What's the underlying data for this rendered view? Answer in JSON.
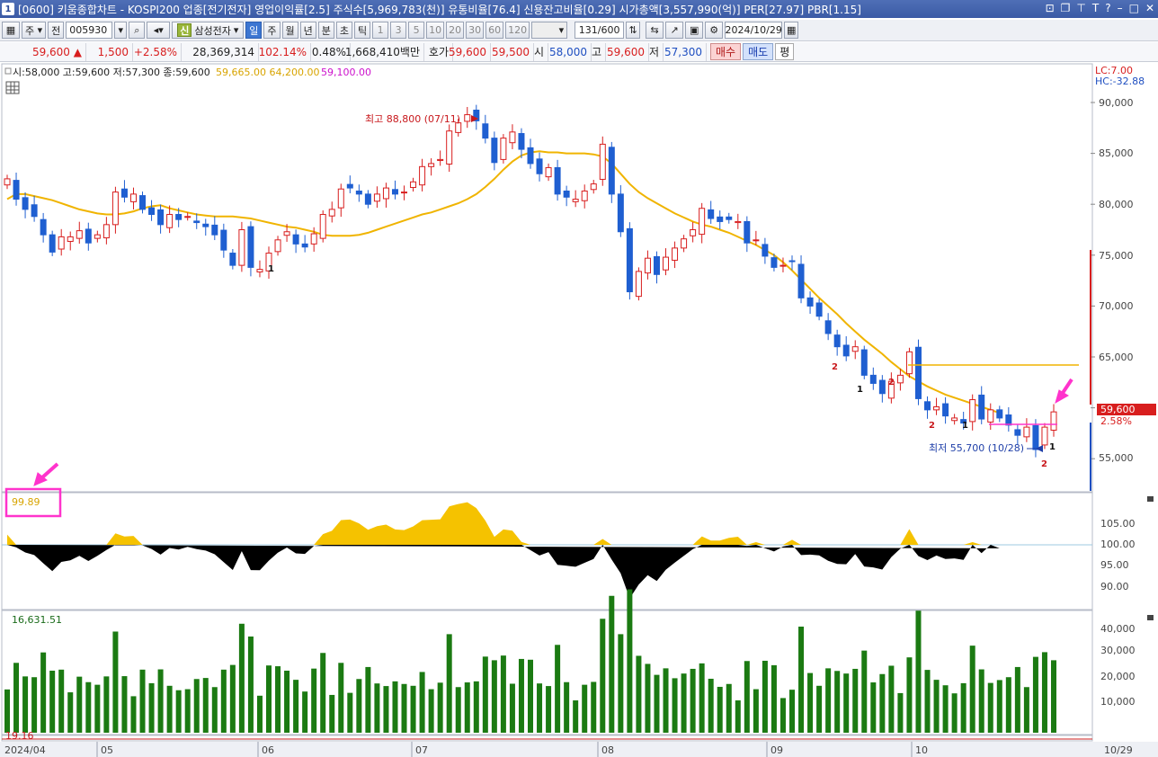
{
  "window": {
    "id": "1",
    "title": "[0600] 키움종합차트 - KOSPI200 업종[전기전자] 영업이익률[2.5] 주식수[5,969,783(천)] 유통비율[76.4] 신용잔고비율[0.29] 시가총액[3,557,990(억)] PER[27.97] PBR[1.15]"
  },
  "toolbar": {
    "market": "주",
    "all": "전",
    "code": "005930",
    "credit_badge": "신",
    "stock_name": "삼성전자",
    "periods": [
      "일",
      "주",
      "월",
      "년",
      "분",
      "초",
      "틱"
    ],
    "active_period": "일",
    "intervals": [
      "1",
      "3",
      "5",
      "10",
      "20",
      "30",
      "60",
      "120"
    ],
    "count": "131",
    "count_max": "/600",
    "date": "2024/10/29"
  },
  "quote": {
    "price": "59,600",
    "arrow": "▲",
    "change": "1,500",
    "change_pct": "+2.58%",
    "volume": "28,369,314",
    "volume_ratio": "102.14%",
    "turnover": "0.48%",
    "amount": "1,668,410백만",
    "hoga_label": "호가",
    "ask": "59,600",
    "bid": "59,500",
    "open_label": "시",
    "open": "58,000",
    "high_label": "고",
    "high": "59,600",
    "low_label": "저",
    "low": "57,300",
    "buy_label": "매수",
    "sell_label": "매도",
    "avg_label": "평"
  },
  "price_panel": {
    "ohlc_legend": "시:58,000 고:59,600 저:57,300 종:59,600",
    "ma_legend_1": "59,665.00 64,200.00",
    "ma_legend_2": "59,100.00",
    "lc": "LC:7.00",
    "hc": "HC:-32.88",
    "max_annotation": "최고 88,800 (07/11)",
    "min_annotation": "최저 55,700 (10/28)",
    "current_price_tag": "59,600",
    "current_pct_tag": "2.58%",
    "y_ticks": [
      "90,000",
      "85,000",
      "80,000",
      "75,000",
      "70,000",
      "65,000",
      "55,000"
    ],
    "colors": {
      "up": "#d81e1e",
      "down": "#1f5fd1",
      "ma": "#f0b400",
      "highlight": "#ff33cc"
    }
  },
  "indicator_panel": {
    "value": "99.89",
    "y_ticks": [
      "105.00",
      "100.00",
      "95.00",
      "90.00"
    ]
  },
  "volume_panel": {
    "value": "16,631.51",
    "y_ticks": [
      "40,000",
      "30,000",
      "20,000",
      "10,000"
    ]
  },
  "bottom_panel": {
    "value": "19.16"
  },
  "x_axis": {
    "labels": [
      "2024/04",
      "05",
      "06",
      "07",
      "08",
      "09",
      "10"
    ],
    "last": "10/29"
  },
  "chart_data": {
    "type": "candlestick",
    "ma_line": [
      80500,
      81000,
      81000,
      80800,
      80600,
      80400,
      80100,
      79800,
      79500,
      79300,
      79100,
      79000,
      79000,
      79100,
      79300,
      79600,
      79800,
      79900,
      79600,
      79400,
      79200,
      79000,
      78900,
      78800,
      78800,
      78800,
      78700,
      78600,
      78400,
      78200,
      78000,
      77800,
      77700,
      77500,
      77300,
      77000,
      76900,
      76900,
      76900,
      77000,
      77200,
      77500,
      77800,
      78100,
      78400,
      78700,
      79000,
      79200,
      79500,
      79800,
      80100,
      80500,
      81000,
      81700,
      82500,
      83400,
      84200,
      84800,
      85100,
      85200,
      85100,
      85100,
      85000,
      85000,
      85000,
      84900,
      84700,
      84000,
      83000,
      82000,
      81200,
      80600,
      80100,
      79600,
      79100,
      78700,
      78300,
      78000,
      77800,
      77500,
      77200,
      76800,
      76400,
      76000,
      75500,
      75000,
      74300,
      73500,
      72600,
      71700,
      70800,
      70000,
      69200,
      68300,
      67500,
      66700,
      66000,
      65300,
      64500,
      63800,
      63100,
      62600,
      62100,
      61700,
      61300,
      61000,
      60700,
      60400,
      60100,
      59800,
      59500
    ],
    "closes": [
      82500,
      80500,
      79500,
      78800,
      77000,
      75300,
      76800,
      76800,
      77400,
      76200,
      77000,
      78000,
      81200,
      80700,
      81000,
      79500,
      79000,
      78000,
      79000,
      78500,
      78800,
      78200,
      77800,
      77000,
      75500,
      74000,
      77500,
      73800,
      73600,
      75200,
      76500,
      77300,
      76100,
      75800,
      77100,
      79000,
      79500,
      81500,
      81600,
      81000,
      80000,
      81000,
      81600,
      81000,
      81200,
      82200,
      83700,
      84000,
      84400,
      87200,
      88000,
      88800,
      88200,
      86500,
      84100,
      86500,
      87100,
      85400,
      84000,
      83000,
      83600,
      81000,
      80700,
      80500,
      81300,
      82000,
      85900,
      81000,
      77300,
      71400,
      73400,
      74700,
      73100,
      74800,
      75700,
      76600,
      77500,
      79600,
      78600,
      78300,
      78500,
      78300,
      76200,
      76500,
      74900,
      73800,
      74000,
      74400,
      70800,
      70000,
      69000,
      67300,
      66000,
      65100,
      66000,
      63200,
      62400,
      61400,
      62600,
      63200,
      65500,
      60900,
      59800,
      60100,
      59200,
      59000,
      58500,
      60800,
      58900,
      59800,
      59000,
      58300,
      57300,
      58100,
      55900,
      58100,
      59600
    ]
  }
}
